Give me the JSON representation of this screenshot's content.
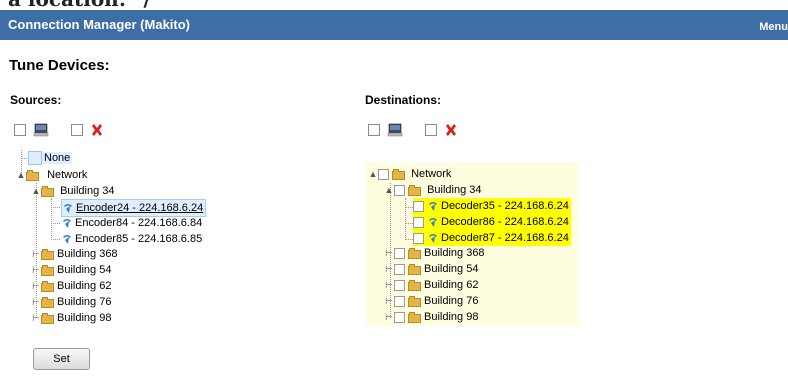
{
  "header": {
    "title": "Connection Manager (Makito)",
    "menu_label": "Menu"
  },
  "top_overflow_text": "a location:\" /",
  "page_title": "Tune Devices:",
  "sources": {
    "label": "Sources:",
    "tree": {
      "none_label": "None",
      "network_label": "Network",
      "building_expanded": "Building 34",
      "encoders": [
        "Encoder24 - 224.168.6.24",
        "Encoder84 - 224.168.6.84",
        "Encoder85 - 224.168.6.85"
      ],
      "other_buildings": [
        "Building 368",
        "Building 54",
        "Building 62",
        "Building 76",
        "Building 98"
      ]
    }
  },
  "destinations": {
    "label": "Destinations:",
    "tree": {
      "network_label": "Network",
      "building_expanded": "Building 34",
      "decoders": [
        "Decoder35 - 224.168.6.24",
        "Decoder86 - 224.168.6.24",
        "Decoder87 - 224.168.6.24"
      ],
      "other_buildings": [
        "Building 368",
        "Building 54",
        "Building 62",
        "Building 76",
        "Building 98"
      ]
    }
  },
  "set_button_label": "Set",
  "colors": {
    "header_bg": "#3d6ea5",
    "highlight": "#ffff00",
    "selected_bg": "#dfeeff"
  },
  "icons": {
    "monitor": "monitor-icon",
    "delete": "delete-x-icon",
    "encoder": "encoder-icon",
    "folder": "folder-icon"
  }
}
